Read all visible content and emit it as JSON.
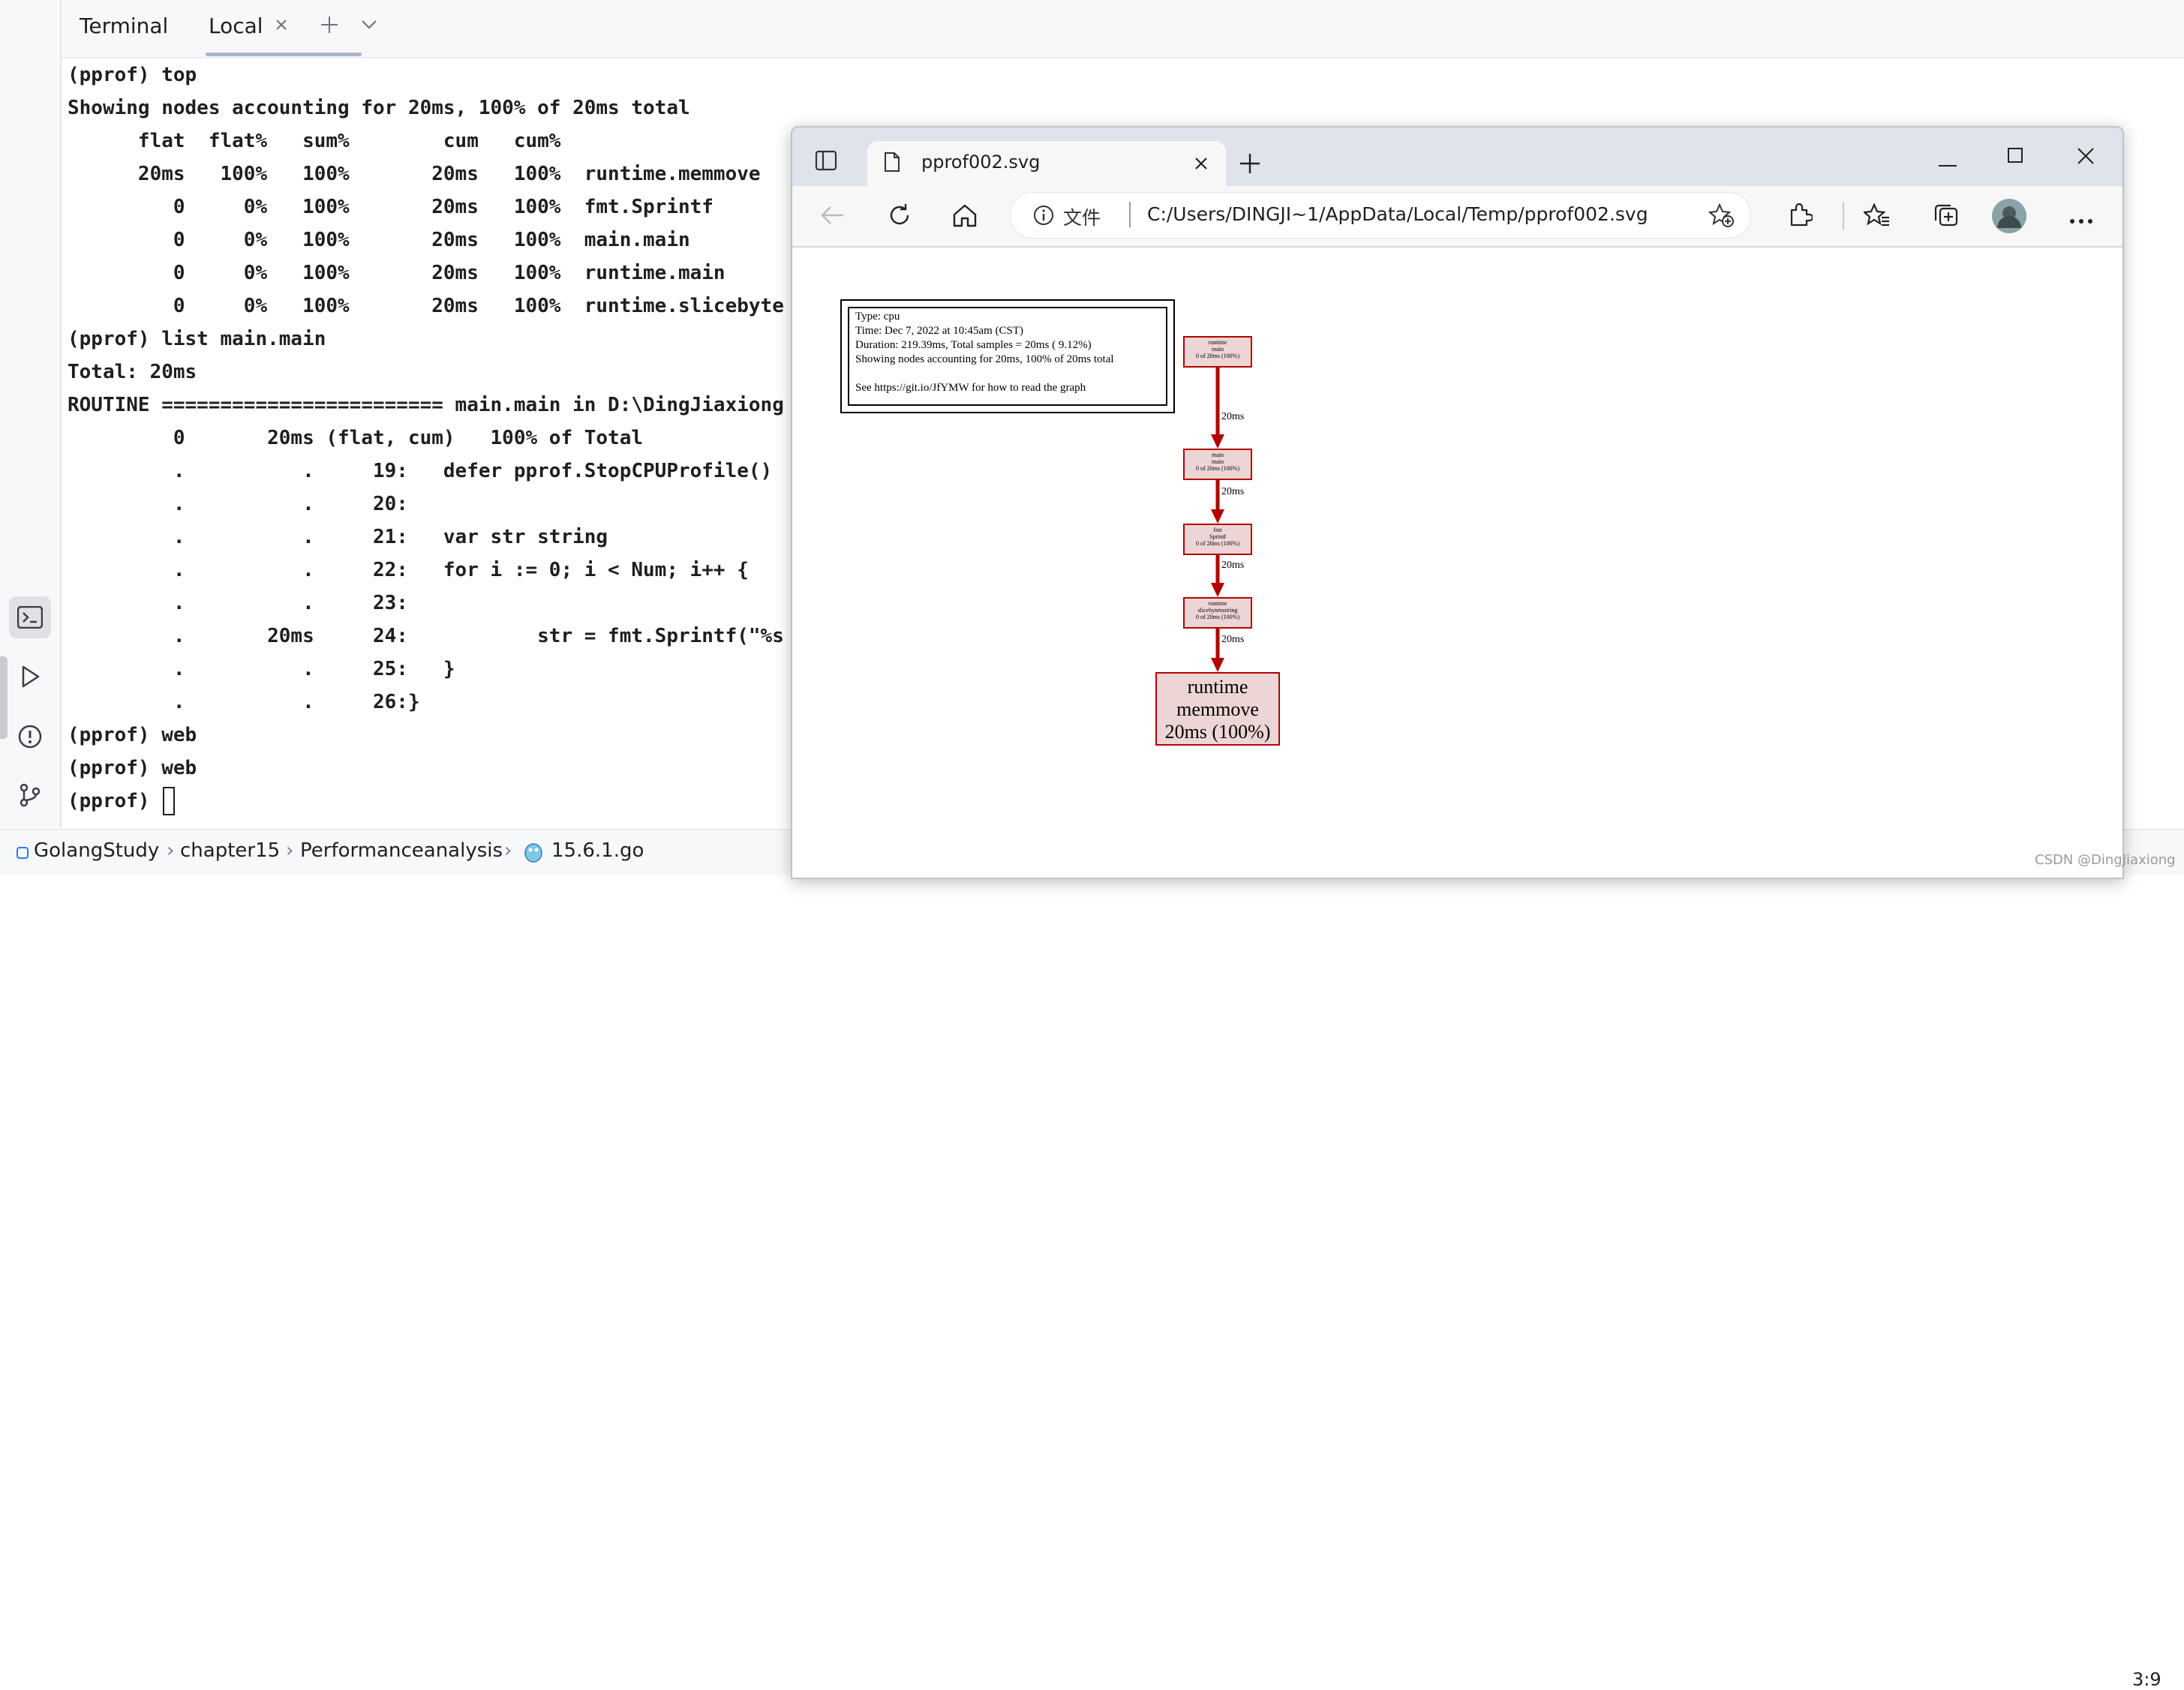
{
  "ide": {
    "tool_window_title": "Terminal",
    "tabs": [
      {
        "label": "Local",
        "active": true
      }
    ],
    "terminal_lines": [
      "(pprof) top",
      "Showing nodes accounting for 20ms, 100% of 20ms total",
      "      flat  flat%   sum%        cum   cum%",
      "      20ms   100%   100%       20ms   100%  runtime.memmove",
      "         0     0%   100%       20ms   100%  fmt.Sprintf",
      "         0     0%   100%       20ms   100%  main.main",
      "         0     0%   100%       20ms   100%  runtime.main",
      "         0     0%   100%       20ms   100%  runtime.slicebyte",
      "(pprof) list main.main",
      "Total: 20ms",
      "ROUTINE ======================== main.main in D:\\DingJiaxiong",
      "         0       20ms (flat, cum)   100% of Total",
      "         .          .     19:   defer pprof.StopCPUProfile()",
      "         .          .     20:",
      "         .          .     21:   var str string",
      "         .          .     22:   for i := 0; i < Num; i++ {",
      "         .          .     23:",
      "         .       20ms     24:           str = fmt.Sprintf(\"%s",
      "         .          .     25:   }",
      "         .          .     26:}",
      "(pprof) web",
      "(pprof) web",
      "(pprof) "
    ],
    "breadcrumb": [
      "GolangStudy",
      "chapter15",
      "Performanceanalysis",
      "15.6.1.go"
    ],
    "cursor_position": "3:9",
    "colors": {
      "accent": "#3574f0",
      "text": "#1e1f22",
      "panel": "#f7f8fa"
    }
  },
  "browser": {
    "tab_title": "pprof002.svg",
    "address_prefix": "文件",
    "address_url": "C:/Users/DINGJI~1/AppData/Local/Temp/pprof002.svg",
    "graph": {
      "legend_lines": [
        "Type: cpu",
        "Time: Dec 7, 2022 at 10:45am (CST)",
        "Duration: 219.39ms, Total samples = 20ms ( 9.12%)",
        "Showing nodes accounting for 20ms, 100% of 20ms total",
        "",
        "See https://git.io/JfYMW for how to read the graph"
      ],
      "nodes": [
        {
          "pkg": "runtime",
          "func": "main",
          "value": "0 of 20ms (100%)"
        },
        {
          "pkg": "main",
          "func": "main",
          "value": "0 of 20ms (100%)"
        },
        {
          "pkg": "fmt",
          "func": "Sprintf",
          "value": "0 of 20ms (100%)"
        },
        {
          "pkg": "runtime",
          "func": "slicebytetostring",
          "value": "0 of 20ms (100%)"
        },
        {
          "pkg": "runtime",
          "func": "memmove",
          "value": "20ms (100%)"
        }
      ],
      "edge_labels": [
        "20ms",
        "20ms",
        "20ms",
        "20ms"
      ],
      "edge_color": "#b20400",
      "node_fill": "#edd5d5"
    }
  },
  "watermark": "CSDN @DingJiaxiong"
}
